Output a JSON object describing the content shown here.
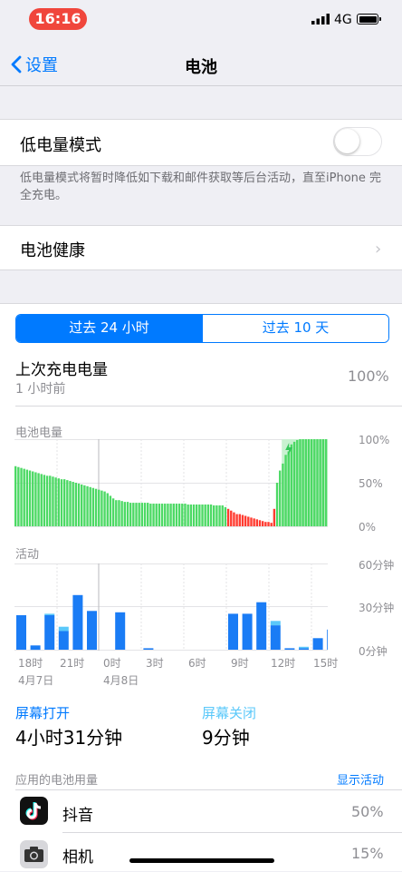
{
  "status_bar": {
    "time": "16:16",
    "network": "4G"
  },
  "nav": {
    "back_label": "设置",
    "title": "电池"
  },
  "low_power": {
    "label": "低电量模式",
    "enabled": false,
    "footnote": "低电量模式将暂时降低如下载和邮件获取等后台活动，直至iPhone 完全充电。"
  },
  "battery_health": {
    "label": "电池健康"
  },
  "segments": [
    {
      "label": "过去 24 小时",
      "selected": true
    },
    {
      "label": "过去 10 天",
      "selected": false
    }
  ],
  "last_charge": {
    "label": "上次充电电量",
    "sub": "1 小时前",
    "value": "100%"
  },
  "battery_chart": {
    "title": "电池电量",
    "y_labels": [
      "100%",
      "50%",
      "0%"
    ]
  },
  "activity_chart": {
    "title": "活动",
    "y_labels": [
      "60分钟",
      "30分钟",
      "0分钟"
    ],
    "x_labels": [
      "18时",
      "21时",
      "0时",
      "3时",
      "6时",
      "9时",
      "12时",
      "15时"
    ],
    "date_labels": [
      "4月7日",
      "4月8日"
    ]
  },
  "chart_data": [
    {
      "type": "bar",
      "title": "电池电量",
      "ylabels": [
        "0%",
        "50%",
        "100%"
      ],
      "ylim": [
        0,
        100
      ],
      "values": [
        69,
        68,
        67,
        66,
        65,
        64,
        63,
        62,
        61,
        60,
        59,
        58,
        58,
        57,
        56,
        55,
        54,
        54,
        53,
        52,
        51,
        50,
        49,
        48,
        47,
        46,
        45,
        44,
        43,
        42,
        41,
        40,
        38,
        35,
        32,
        30,
        30,
        29,
        28,
        28,
        27,
        27,
        27,
        27,
        27,
        27,
        27,
        26,
        26,
        26,
        26,
        26,
        26,
        26,
        26,
        26,
        26,
        26,
        26,
        26,
        25,
        25,
        25,
        25,
        25,
        25,
        25,
        25,
        25,
        24,
        24,
        24,
        24,
        22,
        20,
        18,
        16,
        14,
        14,
        13,
        12,
        11,
        10,
        9,
        8,
        7,
        6,
        5,
        5,
        4,
        20,
        50,
        64,
        72,
        82,
        86,
        94,
        97,
        99,
        100,
        100,
        100,
        100,
        100,
        100,
        100,
        100,
        100,
        100
      ],
      "colors": {
        "normal": "#4cd964",
        "low": "#ff3b30"
      },
      "charging_start_index": 93
    },
    {
      "type": "bar",
      "title": "活动",
      "xlabel": "",
      "ylabels": [
        "0分钟",
        "30分钟",
        "60分钟"
      ],
      "ylim": [
        0,
        60
      ],
      "categories": [
        "18时",
        "",
        "",
        "21时",
        "",
        "",
        "0时",
        "",
        "",
        "3时",
        "",
        "",
        "6时",
        "",
        "",
        "9时",
        "",
        "",
        "12时",
        "",
        "",
        "15时",
        "",
        ""
      ],
      "series": [
        {
          "name": "屏幕打开",
          "values": [
            24,
            3,
            24,
            13,
            38,
            27,
            0,
            26,
            0,
            1,
            0,
            0,
            0,
            0,
            0,
            25,
            25,
            33,
            17,
            1,
            1,
            8,
            14,
            2
          ]
        },
        {
          "name": "屏幕关闭",
          "values": [
            0,
            0,
            1,
            3,
            0,
            0,
            0,
            0,
            0,
            0,
            0,
            0,
            0,
            0,
            0,
            0,
            0,
            0,
            3,
            0,
            1,
            0,
            0,
            0
          ]
        }
      ],
      "colors": {
        "screen_on": "#1a7cf5",
        "screen_off": "#5ac8fa"
      }
    }
  ],
  "screen_on": {
    "label": "屏幕打开",
    "value": "4小时31分钟"
  },
  "screen_off": {
    "label": "屏幕关闭",
    "value": "9分钟"
  },
  "app_usage": {
    "header": "应用的电池用量",
    "action": "显示活动",
    "apps": [
      {
        "name": "抖音",
        "percent": "50%",
        "icon": "douyin-icon"
      },
      {
        "name": "相机",
        "percent": "15%",
        "icon": "camera-icon"
      }
    ]
  }
}
